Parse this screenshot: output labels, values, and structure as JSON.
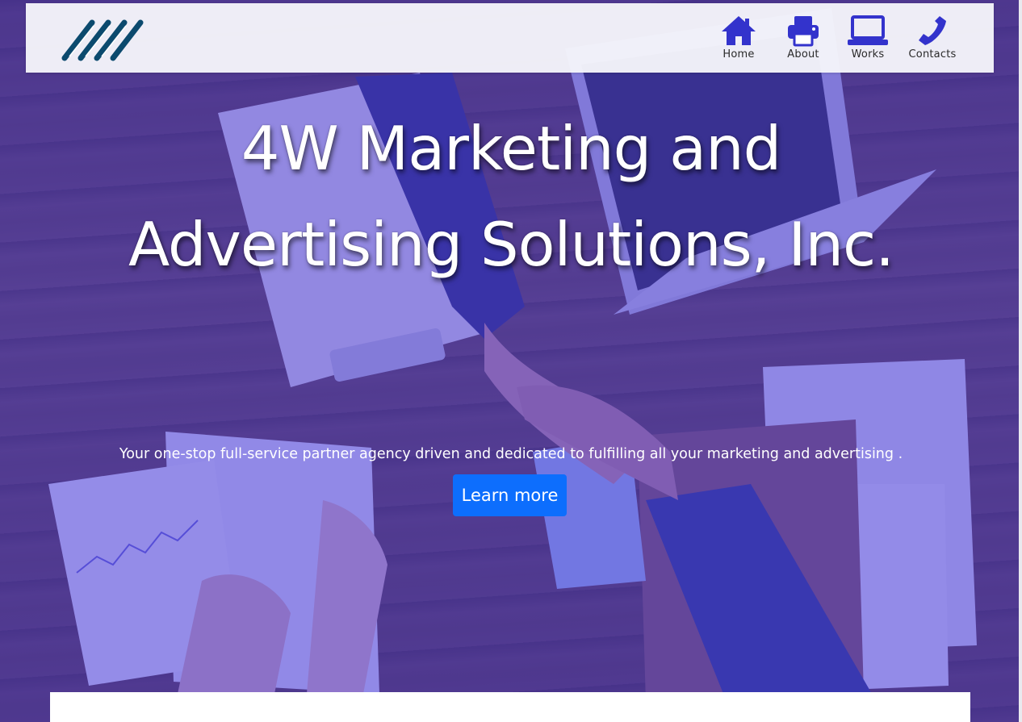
{
  "brand": {
    "logo_icon": "4w-stripes-logo",
    "logo_color": "#0b4a6e"
  },
  "nav": {
    "icon_color": "#3333cc",
    "items": [
      {
        "label": "Home",
        "icon": "home-icon"
      },
      {
        "label": "About",
        "icon": "printer-icon"
      },
      {
        "label": "Works",
        "icon": "laptop-icon"
      },
      {
        "label": "Contacts",
        "icon": "phone-icon"
      }
    ]
  },
  "hero": {
    "title_line1": "4W Marketing and",
    "title_line2": "Advertising Solutions, Inc.",
    "tagline": "Your one-stop full-service partner agency driven and dedicated to fulfilling all your marketing and advertising .",
    "cta_label": "Learn more",
    "cta_color": "#0d6efd",
    "overlay_color": "#4637dc"
  }
}
